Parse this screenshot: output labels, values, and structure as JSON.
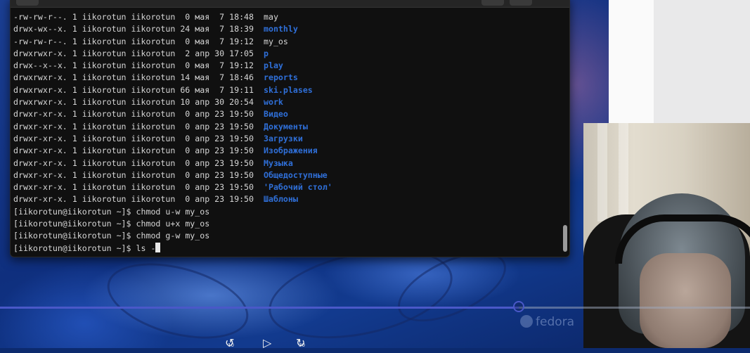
{
  "terminal": {
    "listing": [
      {
        "perms": "-rw-rw-r--.",
        "links": "1",
        "owner": "iikorotun",
        "group": "iikorotun",
        "size": " 0",
        "month": "мая",
        "day": " 7",
        "time": "18:48",
        "name": "may",
        "is_dir": false
      },
      {
        "perms": "drwx-wx--x.",
        "links": "1",
        "owner": "iikorotun",
        "group": "iikorotun",
        "size": "24",
        "month": "мая",
        "day": " 7",
        "time": "18:39",
        "name": "monthly",
        "is_dir": true
      },
      {
        "perms": "-rw-rw-r--.",
        "links": "1",
        "owner": "iikorotun",
        "group": "iikorotun",
        "size": " 0",
        "month": "мая",
        "day": " 7",
        "time": "19:12",
        "name": "my_os",
        "is_dir": false
      },
      {
        "perms": "drwxrwxr-x.",
        "links": "1",
        "owner": "iikorotun",
        "group": "iikorotun",
        "size": " 2",
        "month": "апр",
        "day": "30",
        "time": "17:05",
        "name": "p",
        "is_dir": true
      },
      {
        "perms": "drwx--x--x.",
        "links": "1",
        "owner": "iikorotun",
        "group": "iikorotun",
        "size": " 0",
        "month": "мая",
        "day": " 7",
        "time": "19:12",
        "name": "play",
        "is_dir": true
      },
      {
        "perms": "drwxrwxr-x.",
        "links": "1",
        "owner": "iikorotun",
        "group": "iikorotun",
        "size": "14",
        "month": "мая",
        "day": " 7",
        "time": "18:46",
        "name": "reports",
        "is_dir": true
      },
      {
        "perms": "drwxrwxr-x.",
        "links": "1",
        "owner": "iikorotun",
        "group": "iikorotun",
        "size": "66",
        "month": "мая",
        "day": " 7",
        "time": "19:11",
        "name": "ski.plases",
        "is_dir": true
      },
      {
        "perms": "drwxrwxr-x.",
        "links": "1",
        "owner": "iikorotun",
        "group": "iikorotun",
        "size": "10",
        "month": "апр",
        "day": "30",
        "time": "20:54",
        "name": "work",
        "is_dir": true
      },
      {
        "perms": "drwxr-xr-x.",
        "links": "1",
        "owner": "iikorotun",
        "group": "iikorotun",
        "size": " 0",
        "month": "апр",
        "day": "23",
        "time": "19:50",
        "name": "Видео",
        "is_dir": true
      },
      {
        "perms": "drwxr-xr-x.",
        "links": "1",
        "owner": "iikorotun",
        "group": "iikorotun",
        "size": " 0",
        "month": "апр",
        "day": "23",
        "time": "19:50",
        "name": "Документы",
        "is_dir": true
      },
      {
        "perms": "drwxr-xr-x.",
        "links": "1",
        "owner": "iikorotun",
        "group": "iikorotun",
        "size": " 0",
        "month": "апр",
        "day": "23",
        "time": "19:50",
        "name": "Загрузки",
        "is_dir": true
      },
      {
        "perms": "drwxr-xr-x.",
        "links": "1",
        "owner": "iikorotun",
        "group": "iikorotun",
        "size": " 0",
        "month": "апр",
        "day": "23",
        "time": "19:50",
        "name": "Изображения",
        "is_dir": true
      },
      {
        "perms": "drwxr-xr-x.",
        "links": "1",
        "owner": "iikorotun",
        "group": "iikorotun",
        "size": " 0",
        "month": "апр",
        "day": "23",
        "time": "19:50",
        "name": "Музыка",
        "is_dir": true
      },
      {
        "perms": "drwxr-xr-x.",
        "links": "1",
        "owner": "iikorotun",
        "group": "iikorotun",
        "size": " 0",
        "month": "апр",
        "day": "23",
        "time": "19:50",
        "name": "Общедоступные",
        "is_dir": true
      },
      {
        "perms": "drwxr-xr-x.",
        "links": "1",
        "owner": "iikorotun",
        "group": "iikorotun",
        "size": " 0",
        "month": "апр",
        "day": "23",
        "time": "19:50",
        "name": "'Рабочий стол'",
        "is_dir": true
      },
      {
        "perms": "drwxr-xr-x.",
        "links": "1",
        "owner": "iikorotun",
        "group": "iikorotun",
        "size": " 0",
        "month": "апр",
        "day": "23",
        "time": "19:50",
        "name": "Шаблоны",
        "is_dir": true
      }
    ],
    "prompt": "[iikorotun@iikorotun ~]$ ",
    "commands": [
      "chmod u-w my_os",
      "chmod u+x my_os",
      "chmod g-w my_os"
    ],
    "current_input": "ls -"
  },
  "player": {
    "progress_percent": 69.2,
    "watermark": "fedora",
    "rewind_seconds": "10",
    "forward_seconds": "30"
  },
  "icons": {
    "rewind": "rewind-10-icon",
    "play": "play-icon",
    "forward": "forward-30-icon"
  },
  "colors": {
    "directory": "#2f6fd8",
    "terminal_bg": "#101010",
    "terminal_text": "#d6d6d6",
    "progress": "#4a58c8"
  }
}
